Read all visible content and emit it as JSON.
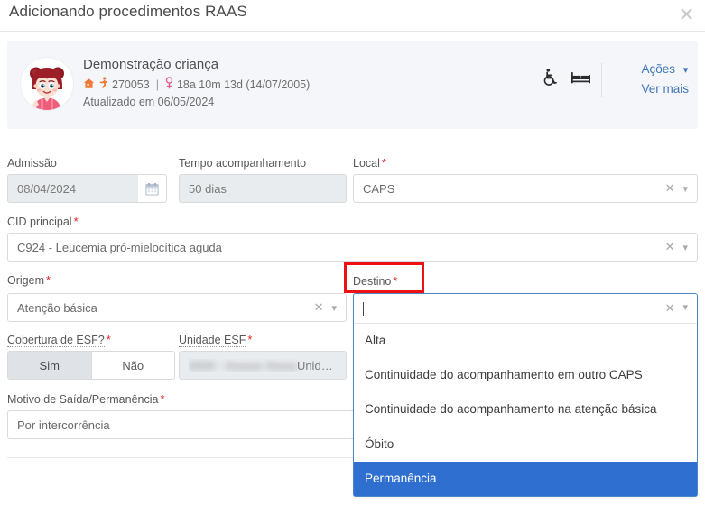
{
  "modal": {
    "title": "Adicionando procedimentos RAAS",
    "close_icon": "close-icon"
  },
  "patient": {
    "name": "Demonstração criança",
    "record_id": "270053",
    "separator": "|",
    "age": "18a 10m 13d (14/07/2005)",
    "updated": "Atualizado em 06/05/2024",
    "icons": [
      "house-icon",
      "runner-icon",
      "female-gender-icon"
    ],
    "banner_icons": [
      "wheelchair-icon",
      "bed-icon"
    ],
    "actions_label": "Ações",
    "see_more_label": "Ver mais"
  },
  "form": {
    "admissao": {
      "label": "Admissão",
      "value": "08/04/2024",
      "required": false,
      "calendar_icon": "calendar-icon"
    },
    "tempo_acompanhamento": {
      "label": "Tempo acompanhamento",
      "value": "50 dias",
      "required": false
    },
    "local": {
      "label": "Local",
      "value": "CAPS",
      "required": true
    },
    "cid_principal": {
      "label": "CID principal",
      "value": "C924 - Leucemia pró-mielocítica aguda",
      "required": true
    },
    "origem": {
      "label": "Origem",
      "value": "Atenção básica",
      "required": true
    },
    "destino": {
      "label": "Destino",
      "value": "",
      "placeholder": "",
      "required": true,
      "options": [
        "Alta",
        "Continuidade do acompanhamento em outro CAPS",
        "Continuidade do acompanhamento na atenção básica",
        "Óbito",
        "Permanência"
      ],
      "selected_option": "Permanência"
    },
    "cobertura_esf": {
      "label": "Cobertura de ESF?",
      "required": true,
      "options": [
        "Sim",
        "Não"
      ],
      "selected": "Sim"
    },
    "unidade_esf": {
      "label": "Unidade ESF",
      "required": true,
      "redacted_value": "0000 - Xxxxxx Xxxxx",
      "value_suffix": "Unidade d"
    },
    "motivo_saida": {
      "label": "Motivo de Saída/Permanência",
      "value": "Por intercorrência",
      "required": true
    }
  },
  "colors": {
    "accent": "#4076b8",
    "required_marker": "#e02020",
    "annotation_box": "#ee1111",
    "selected_option": "#2f6fd0",
    "banner_bg": "#f4f6fa"
  }
}
